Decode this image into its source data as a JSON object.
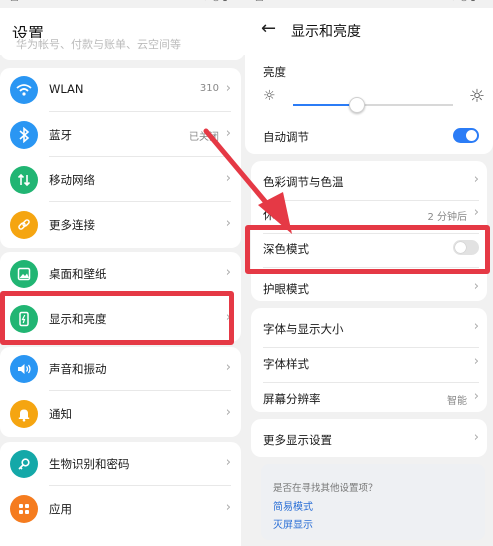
{
  "left_screen": {
    "title": "设置",
    "search_hint": "华为帐号、付款与账单、云空间等",
    "items": [
      {
        "label": "WLAN",
        "value": "310",
        "icon": "wifi-icon",
        "color": "#2a96f3"
      },
      {
        "label": "蓝牙",
        "value": "已关闭",
        "icon": "bluetooth-icon",
        "color": "#2a96f3"
      },
      {
        "label": "移动网络",
        "value": "",
        "icon": "mobile-network-icon",
        "color": "#21b573"
      },
      {
        "label": "更多连接",
        "value": "",
        "icon": "link-icon",
        "color": "#f5a511"
      },
      {
        "label": "桌面和壁纸",
        "value": "",
        "icon": "wallpaper-icon",
        "color": "#21b573"
      },
      {
        "label": "显示和亮度",
        "value": "",
        "icon": "display-icon",
        "color": "#21b573"
      },
      {
        "label": "声音和振动",
        "value": "",
        "icon": "sound-icon",
        "color": "#2a96f3"
      },
      {
        "label": "通知",
        "value": "",
        "icon": "bell-icon",
        "color": "#f5a511"
      },
      {
        "label": "生物识别和密码",
        "value": "",
        "icon": "key-icon",
        "color": "#14a8a8"
      },
      {
        "label": "应用",
        "value": "",
        "icon": "apps-icon",
        "color": "#f57c1f"
      }
    ]
  },
  "right_screen": {
    "title": "显示和亮度",
    "brightness_label": "亮度",
    "brightness_level": 0.4,
    "auto_adjust": {
      "label": "自动调节",
      "on": true
    },
    "color_temp": {
      "label": "色彩调节与色温"
    },
    "sleep": {
      "label": "休眠",
      "value": "2 分钟后"
    },
    "dark_mode": {
      "label": "深色模式",
      "on": false
    },
    "eye_comfort": {
      "label": "护眼模式"
    },
    "font_size": {
      "label": "字体与显示大小"
    },
    "font_style": {
      "label": "字体样式"
    },
    "resolution": {
      "label": "屏幕分辨率",
      "value": "智能"
    },
    "more": {
      "label": "更多显示设置"
    },
    "suggest": {
      "question": "是否在寻找其他设置项？",
      "links": [
        "简易模式",
        "灭屏显示"
      ]
    }
  },
  "colors": {
    "accent": "#2b7cf6",
    "highlight": "#e53945"
  }
}
